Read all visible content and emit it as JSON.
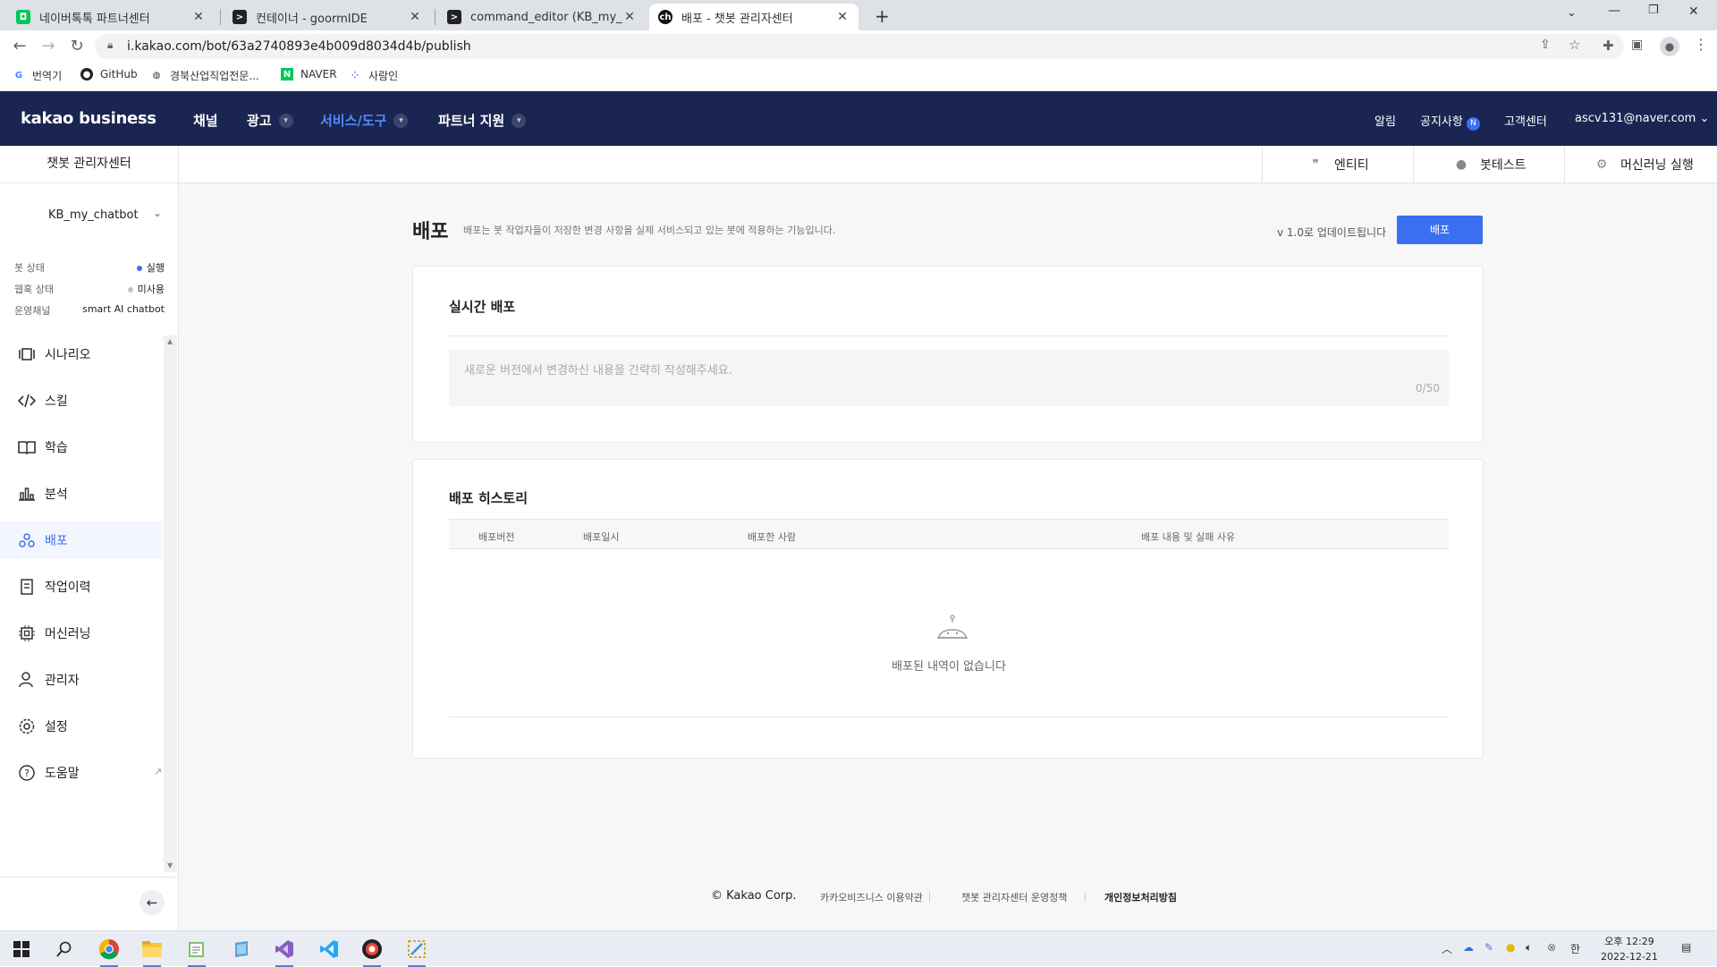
{
  "browser": {
    "tabs": [
      {
        "title": "네이버톡톡 파트너센터",
        "active": false
      },
      {
        "title": "컨테이너 - goormIDE",
        "active": false
      },
      {
        "title": "command_editor (KB_my_chatbo",
        "active": false
      },
      {
        "title": "배포 - 챗봇 관리자센터",
        "active": true
      }
    ],
    "url": "i.kakao.com/bot/63a2740893e4b009d8034d4b/publish",
    "bookmarks": [
      "번역기",
      "GitHub",
      "경북산업직업전문...",
      "NAVER",
      "사람인"
    ]
  },
  "header": {
    "logo": "kakao business",
    "menu": [
      "채널",
      "광고",
      "서비스/도구",
      "파트너 지원"
    ],
    "active_menu": "서비스/도구",
    "right": {
      "alerts": "알림",
      "notice": "공지사항",
      "notice_badge": "N",
      "support": "고객센터",
      "account": "ascv131@naver.com"
    }
  },
  "subheader": {
    "title": "챗봇 관리자센터",
    "tools": [
      "엔티티",
      "봇테스트",
      "머신러닝 실행"
    ]
  },
  "sidebar": {
    "bot_name": "KB_my_chatbot",
    "status": [
      {
        "label": "봇 상태",
        "value": "실행",
        "color": "#3a6ff2"
      },
      {
        "label": "웹훅 상태",
        "value": "미사용",
        "color": "#c4c4c4"
      },
      {
        "label": "운영채널",
        "value": "smart AI chatbot"
      }
    ],
    "items": [
      {
        "label": "시나리오",
        "icon": "scenario-icon"
      },
      {
        "label": "스킬",
        "icon": "code-icon"
      },
      {
        "label": "학습",
        "icon": "book-icon"
      },
      {
        "label": "분석",
        "icon": "chart-icon"
      },
      {
        "label": "배포",
        "icon": "deploy-icon",
        "active": true
      },
      {
        "label": "작업이력",
        "icon": "history-icon"
      },
      {
        "label": "머신러닝",
        "icon": "chip-icon"
      },
      {
        "label": "관리자",
        "icon": "user-icon"
      },
      {
        "label": "설정",
        "icon": "gear-icon"
      },
      {
        "label": "도움말",
        "icon": "help-icon"
      }
    ]
  },
  "page": {
    "title": "배포",
    "description": "배포는 봇 작업자들이 저장한 변경 사항을 실제 서비스되고 있는 봇에 적용하는 기능입니다.",
    "version_note": "v 1.0로 업데이트됩니다",
    "deploy_button": "배포",
    "realtime": {
      "title": "실시간 배포",
      "placeholder": "새로운 버전에서 변경하신 내용을 간략히 작성해주세요.",
      "counter": "0/50"
    },
    "history": {
      "title": "배포 히스토리",
      "columns": [
        "배포버전",
        "배포일시",
        "배포한 사람",
        "배포 내용 및 실패 사유"
      ],
      "empty": "배포된 내역이 없습니다"
    }
  },
  "footer": {
    "copyright": "© Kakao Corp.",
    "links": [
      "카카오비즈니스 이용약관",
      "챗봇 관리자센터 운영정책",
      "개인정보처리방침"
    ]
  },
  "taskbar": {
    "time": "오후 12:29",
    "date": "2022-12-21",
    "ime": "한"
  },
  "colors": {
    "brand_navy": "#1b2551",
    "accent_blue": "#3a6ff2"
  }
}
